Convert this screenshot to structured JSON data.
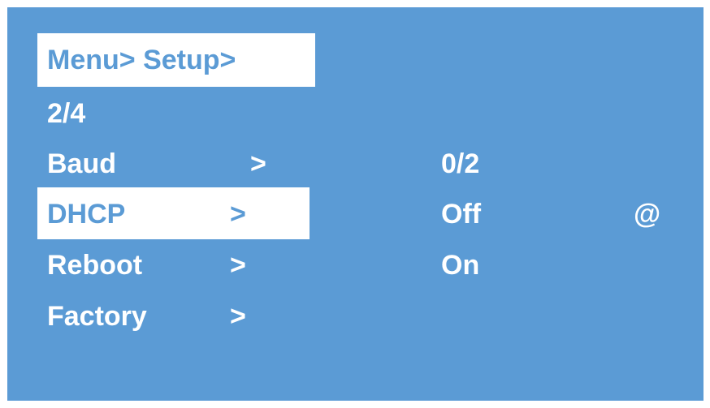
{
  "breadcrumb": "Menu> Setup>",
  "page_indicator": "2/4",
  "menu": {
    "items": [
      {
        "label": "Baud",
        "arrow": ">"
      },
      {
        "label": "DHCP",
        "arrow": ">"
      },
      {
        "label": "Reboot",
        "arrow": ">"
      },
      {
        "label": "Factory",
        "arrow": ">"
      }
    ],
    "selected_item": "DHCP"
  },
  "options": {
    "indicator": "0/2",
    "items": [
      "Off",
      "On"
    ],
    "current_marker": "@"
  },
  "colors": {
    "background": "#5b9bd5",
    "text": "#ffffff",
    "highlight_background": "#ffffff",
    "highlight_text": "#5b9bd5"
  }
}
